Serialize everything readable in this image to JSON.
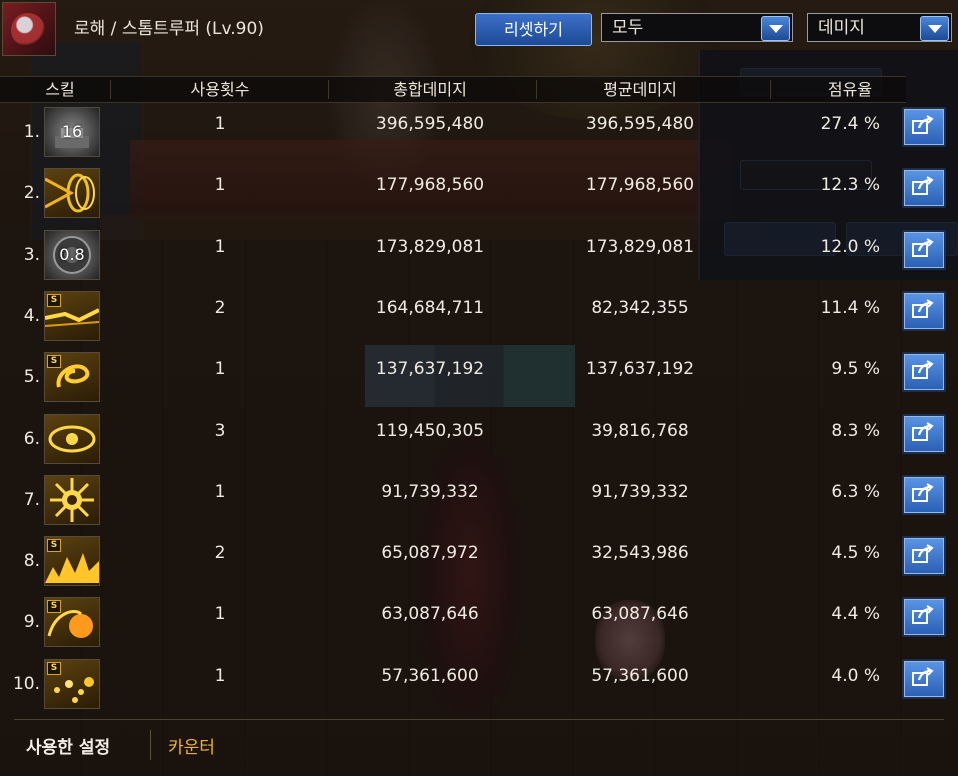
{
  "header": {
    "character_title": "로해 / 스톰트루퍼 (Lv.90)",
    "reset_button": "리셋하기",
    "filter_select": "모두",
    "sort_select": "데미지"
  },
  "columns": {
    "skill": "스킬",
    "count": "사용횟수",
    "total": "총합데미지",
    "average": "평균데미지",
    "share": "점유율"
  },
  "rows": [
    {
      "rank": "1.",
      "icon_label": "16",
      "count": "1",
      "total": "396,595,480",
      "average": "396,595,480",
      "share": "27.4 %"
    },
    {
      "rank": "2.",
      "icon_label": "",
      "count": "1",
      "total": "177,968,560",
      "average": "177,968,560",
      "share": "12.3 %"
    },
    {
      "rank": "3.",
      "icon_label": "0.8",
      "count": "1",
      "total": "173,829,081",
      "average": "173,829,081",
      "share": "12.0 %"
    },
    {
      "rank": "4.",
      "icon_label": "",
      "count": "2",
      "total": "164,684,711",
      "average": "82,342,355",
      "share": "11.4 %"
    },
    {
      "rank": "5.",
      "icon_label": "",
      "count": "1",
      "total": "137,637,192",
      "average": "137,637,192",
      "share": "9.5 %"
    },
    {
      "rank": "6.",
      "icon_label": "",
      "count": "3",
      "total": "119,450,305",
      "average": "39,816,768",
      "share": "8.3 %"
    },
    {
      "rank": "7.",
      "icon_label": "",
      "count": "1",
      "total": "91,739,332",
      "average": "91,739,332",
      "share": "6.3 %"
    },
    {
      "rank": "8.",
      "icon_label": "",
      "count": "2",
      "total": "65,087,972",
      "average": "32,543,986",
      "share": "4.5 %"
    },
    {
      "rank": "9.",
      "icon_label": "",
      "count": "1",
      "total": "63,087,646",
      "average": "63,087,646",
      "share": "4.4 %"
    },
    {
      "rank": "10.",
      "icon_label": "",
      "count": "1",
      "total": "57,361,600",
      "average": "57,361,600",
      "share": "4.0 %"
    }
  ],
  "skill_icons": [
    "dragon-shot-icon",
    "golden-rings-icon",
    "gear-burst-icon",
    "lightning-beam-icon",
    "golden-dragon-icon",
    "eye-shield-icon",
    "sun-blast-icon",
    "flame-wave-icon",
    "fire-orb-icon",
    "spark-scatter-icon"
  ],
  "skill_s_badge": "S",
  "footer": {
    "used_settings": "사용한 설정",
    "counter": "카운터"
  },
  "colors": {
    "accent_blue": "#2a5fb4",
    "counter_orange": "#f2b230",
    "text": "#f0ebe2"
  }
}
